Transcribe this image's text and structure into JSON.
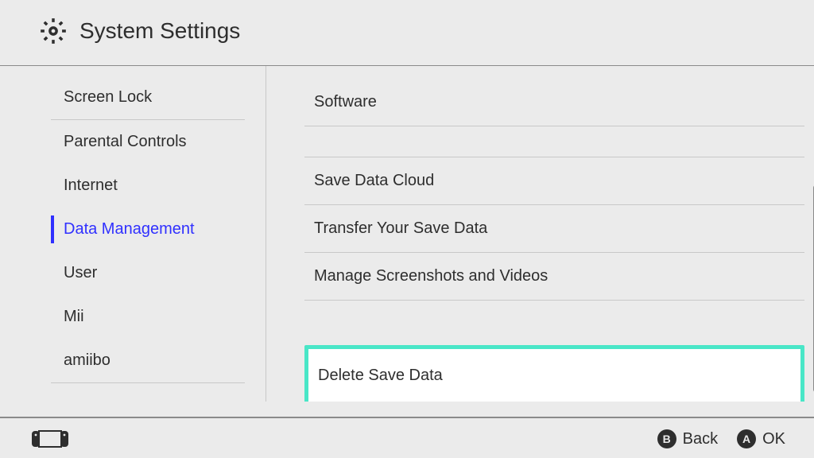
{
  "header": {
    "title": "System Settings"
  },
  "sidebar": {
    "items": [
      {
        "label": "Screen Lock",
        "selected": false
      },
      {
        "label": "Parental Controls",
        "selected": false
      },
      {
        "label": "Internet",
        "selected": false
      },
      {
        "label": "Data Management",
        "selected": true
      },
      {
        "label": "User",
        "selected": false
      },
      {
        "label": "Mii",
        "selected": false
      },
      {
        "label": "amiibo",
        "selected": false
      }
    ]
  },
  "main": {
    "items": [
      {
        "label": "Software",
        "highlighted": false
      },
      {
        "label": "Save Data Cloud",
        "highlighted": false
      },
      {
        "label": "Transfer Your Save Data",
        "highlighted": false
      },
      {
        "label": "Manage Screenshots and Videos",
        "highlighted": false
      },
      {
        "label": "Delete Save Data",
        "highlighted": true
      }
    ]
  },
  "footer": {
    "back": {
      "button": "B",
      "label": "Back"
    },
    "ok": {
      "button": "A",
      "label": "OK"
    }
  }
}
